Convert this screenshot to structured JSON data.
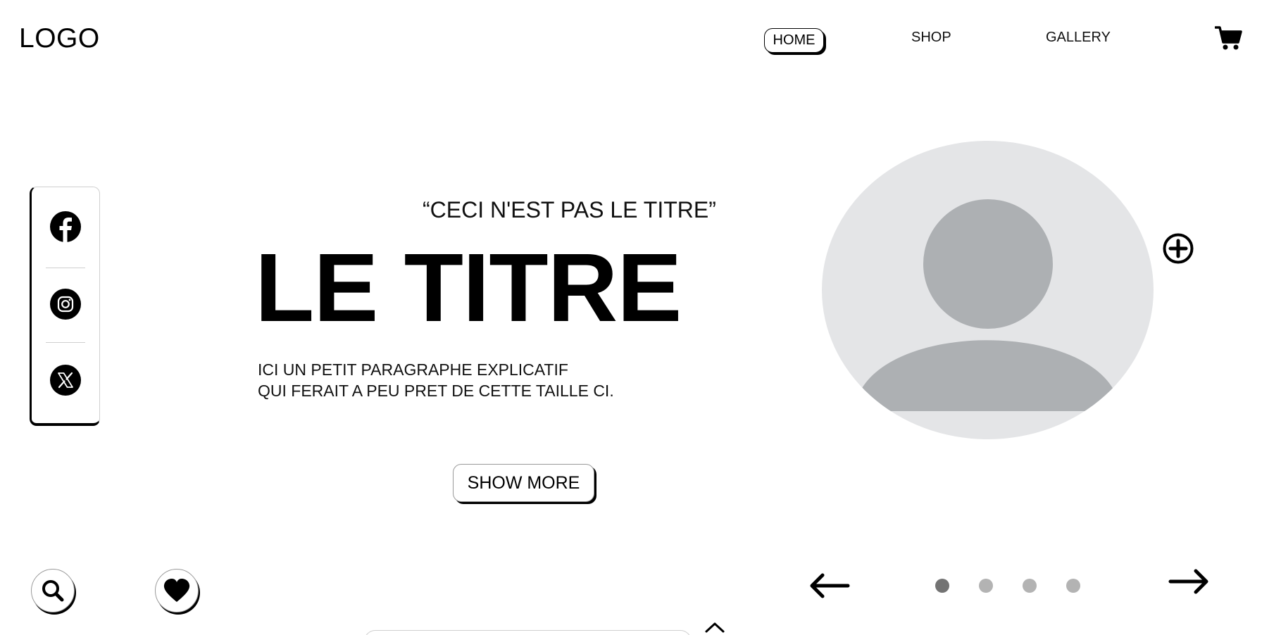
{
  "header": {
    "logo": "LOGO",
    "nav": {
      "home": "HOME",
      "shop": "SHOP",
      "gallery": "GALLERY"
    },
    "cart_icon": "cart-icon"
  },
  "social": {
    "items": [
      {
        "name": "facebook",
        "icon": "facebook-icon"
      },
      {
        "name": "instagram",
        "icon": "instagram-icon"
      },
      {
        "name": "x",
        "icon": "x-icon"
      }
    ]
  },
  "hero": {
    "quote": "“CECI N'EST PAS LE TITRE”",
    "title": "LE TITRE",
    "paragraph_line1": "ICI UN PETIT PARAGRAPHE EXPLICATIF",
    "paragraph_line2": "QUI FERAIT A PEU PRET DE CETTE TAILLE CI.",
    "button": "SHOW MORE"
  },
  "avatar": {
    "icon": "user-placeholder-icon",
    "add_icon": "add-circle-icon"
  },
  "carousel": {
    "prev_icon": "arrow-left-icon",
    "next_icon": "arrow-right-icon",
    "dots": 4,
    "active_index": 0
  },
  "bottom_actions": {
    "search_icon": "search-icon",
    "heart_icon": "heart-icon",
    "caret_icon": "chevron-up-icon"
  },
  "colors": {
    "text": "#000000",
    "avatar_bg": "#e4e5e7",
    "avatar_fg": "#adb0b3",
    "dot_active": "#737373",
    "dot_inactive": "#b3b3b3",
    "divider": "#cfcfcf"
  }
}
